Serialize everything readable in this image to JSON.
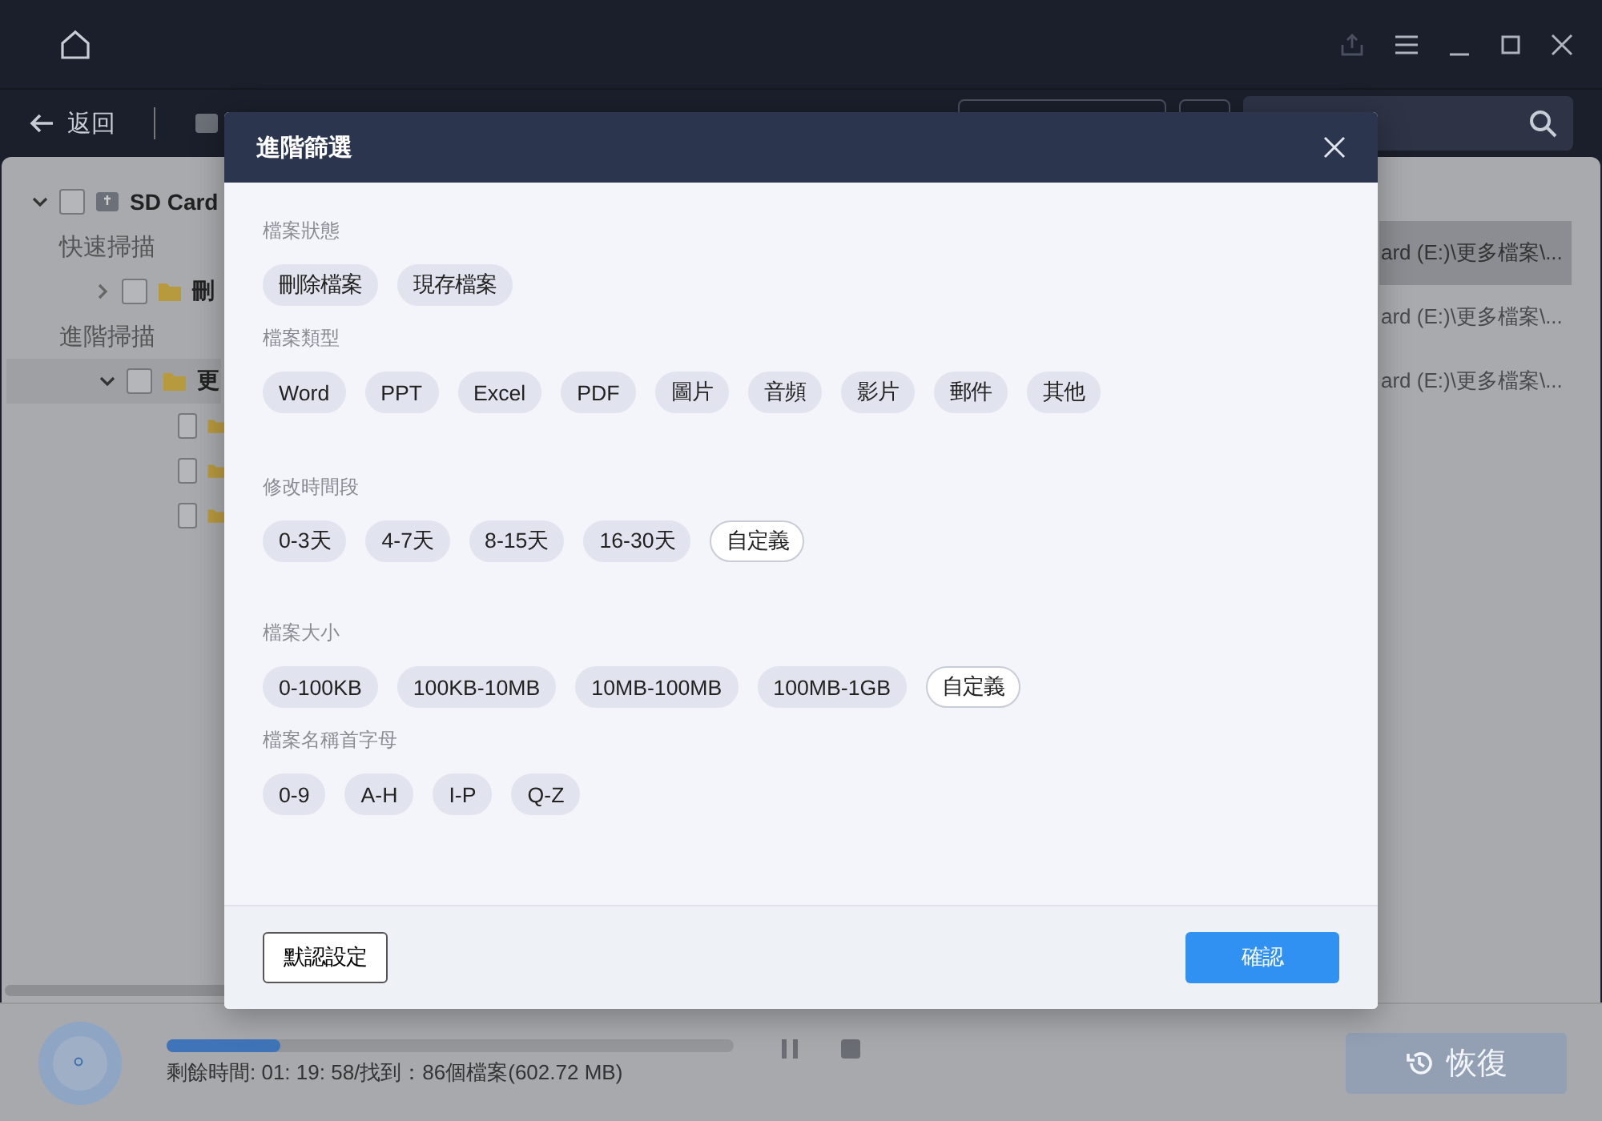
{
  "toolbar": {
    "back": "返回"
  },
  "tree": [
    {
      "label": "SD Card",
      "kind": "drive",
      "checked": false,
      "expanded": true,
      "selected": false,
      "children": [
        {
          "label": "快速掃描",
          "kind": "group"
        },
        {
          "label": "刪",
          "kind": "folder",
          "checked": false,
          "expanded": false,
          "selected": false
        },
        {
          "label": "進階掃描",
          "kind": "group"
        },
        {
          "label": "更",
          "kind": "folder",
          "checked": false,
          "expanded": true,
          "selected": true,
          "children": [
            {
              "kind": "folder",
              "checked": false,
              "selected": false
            },
            {
              "kind": "folder",
              "checked": false,
              "selected": false
            },
            {
              "kind": "folder",
              "checked": false,
              "selected": false
            }
          ]
        }
      ]
    }
  ],
  "file_rows": [
    {
      "path": "ard (E:)\\更多檔案\\...",
      "selected": true
    },
    {
      "path": "ard (E:)\\更多檔案\\...",
      "selected": false
    },
    {
      "path": "ard (E:)\\更多檔案\\...",
      "selected": false
    }
  ],
  "status": {
    "level": 0.2,
    "text": "剩餘時間: 01: 19: 58/找到：86個檔案(602.72 MB)",
    "recover_button": {
      "label": "恢復",
      "disabled": true
    }
  },
  "dialog": {
    "title": "進階篩選",
    "sections": [
      {
        "label": "檔案狀態",
        "chips": [
          {
            "label": "刪除檔案",
            "kind": "option"
          },
          {
            "label": "現存檔案",
            "kind": "option"
          }
        ]
      },
      {
        "label": "檔案類型",
        "chips": [
          {
            "label": "Word",
            "kind": "option"
          },
          {
            "label": "PPT",
            "kind": "option"
          },
          {
            "label": "Excel",
            "kind": "option"
          },
          {
            "label": "PDF",
            "kind": "option"
          },
          {
            "label": "圖片",
            "kind": "option"
          },
          {
            "label": "音頻",
            "kind": "option"
          },
          {
            "label": "影片",
            "kind": "option"
          },
          {
            "label": "郵件",
            "kind": "option"
          },
          {
            "label": "其他",
            "kind": "option"
          }
        ]
      },
      {
        "label": "修改時間段",
        "chips": [
          {
            "label": "0-3天",
            "kind": "option"
          },
          {
            "label": "4-7天",
            "kind": "option"
          },
          {
            "label": "8-15天",
            "kind": "option"
          },
          {
            "label": "16-30天",
            "kind": "option"
          },
          {
            "label": "自定義",
            "kind": "custom"
          }
        ]
      },
      {
        "label": "檔案大小",
        "chips": [
          {
            "label": "0-100KB",
            "kind": "option"
          },
          {
            "label": "100KB-10MB",
            "kind": "option"
          },
          {
            "label": "10MB-100MB",
            "kind": "option"
          },
          {
            "label": "100MB-1GB",
            "kind": "option"
          },
          {
            "label": "自定義",
            "kind": "custom"
          }
        ]
      },
      {
        "label": "檔案名稱首字母",
        "chips": [
          {
            "label": "0-9",
            "kind": "option"
          },
          {
            "label": "A-H",
            "kind": "option"
          },
          {
            "label": "I-P",
            "kind": "option"
          },
          {
            "label": "Q-Z",
            "kind": "option"
          }
        ]
      }
    ],
    "reset_button": "默認設定",
    "confirm_button": "確認"
  }
}
